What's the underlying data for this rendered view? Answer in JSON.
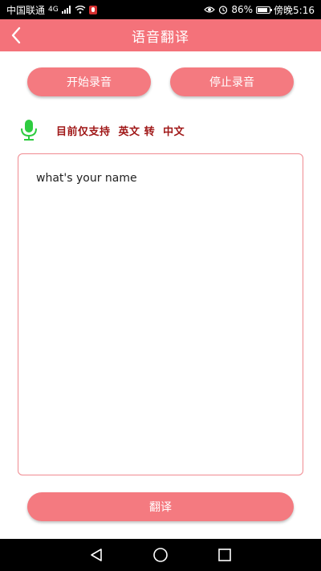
{
  "status_bar": {
    "carrier": "中国联通",
    "network_type": "4G",
    "battery_percent": "86%",
    "battery_level": 0.86,
    "time": "傍晚5:16"
  },
  "header": {
    "title": "语音翻译",
    "back_icon": "chevron-left-icon"
  },
  "controls": {
    "start_label": "开始录音",
    "stop_label": "停止录音"
  },
  "notice": {
    "icon": "microphone-icon",
    "text": "目前仅支持  英文 转  中文",
    "icon_color": "#2ecc40"
  },
  "input": {
    "value": "what's your name"
  },
  "actions": {
    "translate_label": "翻译"
  },
  "colors": {
    "accent": "#f4727a",
    "notice_text": "#a01818"
  }
}
